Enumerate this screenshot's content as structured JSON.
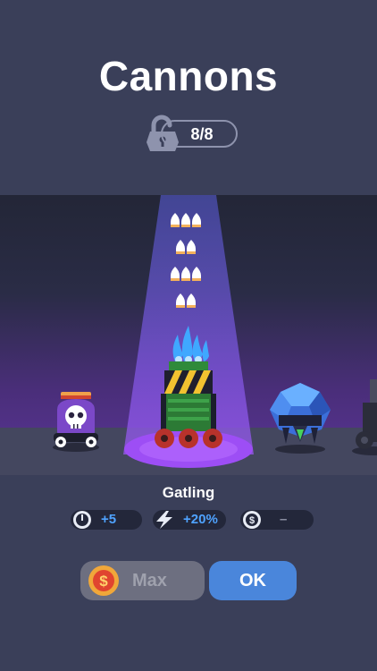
{
  "header": {
    "title": "Cannons",
    "unlock_count": "8/8"
  },
  "showcase": {
    "selected_cannon": "Gatling",
    "cannons": [
      "skull-cannon",
      "gatling-cannon",
      "crystal-cannon",
      "partial-cannon"
    ]
  },
  "stats": [
    {
      "icon": "power-gauge-icon",
      "value": "+5"
    },
    {
      "icon": "lightning-icon",
      "value": "+20%"
    },
    {
      "icon": "coin-icon",
      "value": "–"
    }
  ],
  "buttons": {
    "max_label": "Max",
    "ok_label": "OK"
  },
  "colors": {
    "background": "#3a3f59",
    "accent_blue": "#4a86db",
    "stat_blue": "#4fa3ff",
    "purple_glow": "#7b3fe0"
  }
}
